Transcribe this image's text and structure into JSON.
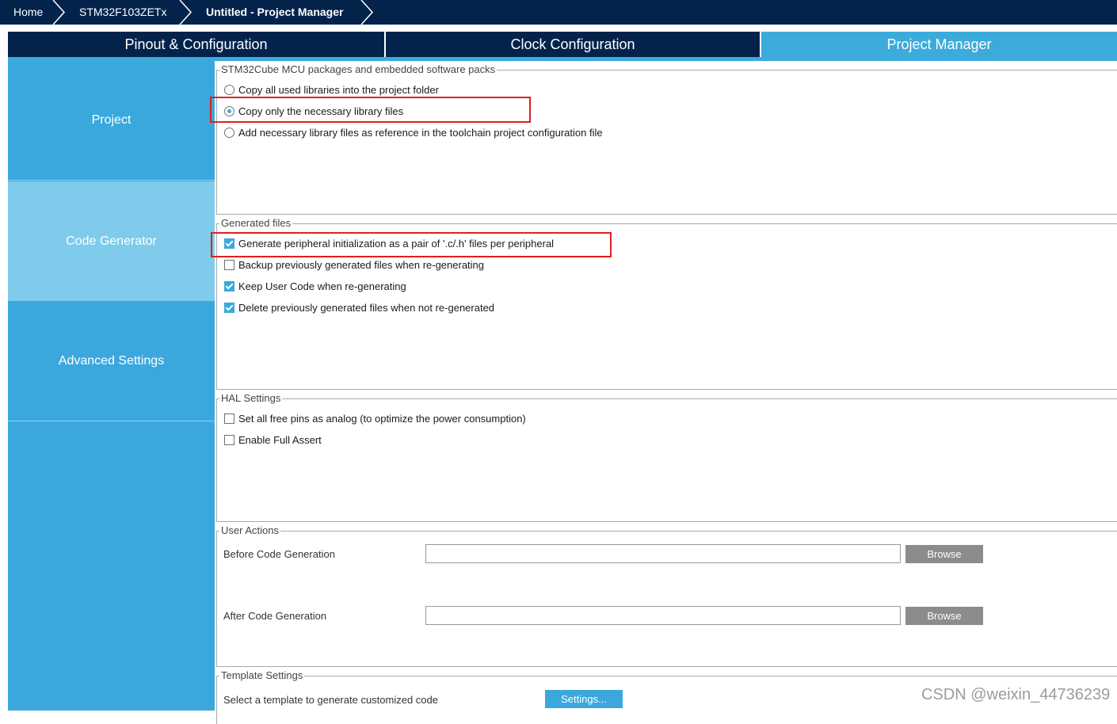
{
  "breadcrumb": [
    "Home",
    "STM32F103ZETx",
    "Untitled - Project Manager"
  ],
  "tabs": [
    "Pinout & Configuration",
    "Clock Configuration",
    "Project Manager"
  ],
  "sidebar": [
    "Project",
    "Code Generator",
    "Advanced Settings"
  ],
  "packages": {
    "title": "STM32Cube MCU packages and embedded software packs",
    "options": [
      {
        "label": "Copy all used libraries into the project folder",
        "selected": false
      },
      {
        "label": "Copy only the necessary library files",
        "selected": true
      },
      {
        "label": "Add necessary library files as reference in the toolchain project configuration file",
        "selected": false
      }
    ]
  },
  "generated": {
    "title": "Generated files",
    "options": [
      {
        "label": "Generate peripheral initialization as a pair of '.c/.h' files per peripheral",
        "checked": true
      },
      {
        "label": "Backup previously generated files when re-generating",
        "checked": false
      },
      {
        "label": "Keep User Code when re-generating",
        "checked": true
      },
      {
        "label": "Delete previously generated files when not re-generated",
        "checked": true
      }
    ]
  },
  "hal": {
    "title": "HAL Settings",
    "options": [
      {
        "label": "Set all free pins as analog (to optimize the power consumption)",
        "checked": false
      },
      {
        "label": "Enable Full Assert",
        "checked": false
      }
    ]
  },
  "user_actions": {
    "title": "User Actions",
    "before_label": "Before Code Generation",
    "before_value": "",
    "after_label": "After Code Generation",
    "after_value": "",
    "browse": "Browse"
  },
  "template": {
    "title": "Template Settings",
    "label": "Select a template to generate customized code",
    "button": "Settings..."
  },
  "watermark": "CSDN @weixin_44736239"
}
